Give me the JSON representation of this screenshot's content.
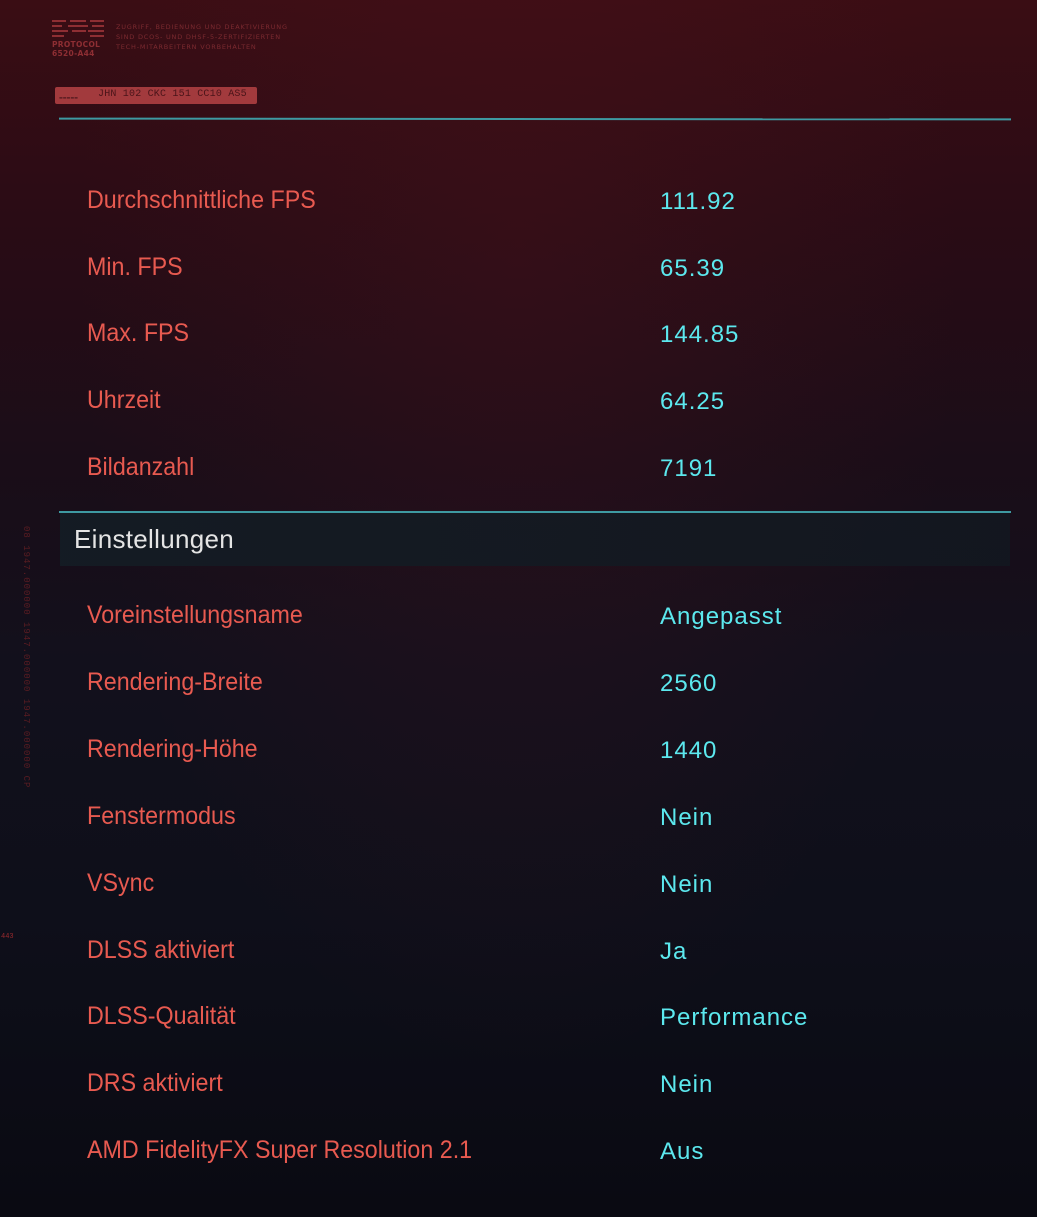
{
  "header": {
    "logo_word_1": "PROTOCOL",
    "logo_word_2": "6520-A44",
    "notice_line_1": "ZUGRIFF, BEDIENUNG UND DEAKTIVIERUNG",
    "notice_line_2": "SIND DCOS- UND DHSF-5-ZERTIFIZIERTEN",
    "notice_line_3": "TECH-MITARBEITERN VORBEHALTEN",
    "tag_code": "JHN 102 CKC 151 CC10 AS5"
  },
  "stats": [
    {
      "label": "Durchschnittliche FPS",
      "value": "111.92"
    },
    {
      "label": "Min. FPS",
      "value": "65.39"
    },
    {
      "label": "Max. FPS",
      "value": "144.85"
    },
    {
      "label": "Uhrzeit",
      "value": "64.25"
    },
    {
      "label": "Bildanzahl",
      "value": "7191"
    }
  ],
  "settings_section": {
    "title": "Einstellungen"
  },
  "settings": [
    {
      "label": "Voreinstellungsname",
      "value": "Angepasst"
    },
    {
      "label": "Rendering-Breite",
      "value": "2560"
    },
    {
      "label": "Rendering-Höhe",
      "value": "1440"
    },
    {
      "label": "Fenstermodus",
      "value": "Nein"
    },
    {
      "label": "VSync",
      "value": "Nein"
    },
    {
      "label": "DLSS aktiviert",
      "value": "Ja"
    },
    {
      "label": "DLSS-Qualität",
      "value": "Performance"
    },
    {
      "label": "DRS aktiviert",
      "value": "Nein"
    },
    {
      "label": "AMD FidelityFX Super Resolution 2.1",
      "value": "Aus"
    }
  ],
  "side": {
    "vertical_code": "08 1947.000000 1947.000000 1947.000000 CP",
    "number": "443"
  },
  "colors": {
    "label": "#e85a50",
    "value": "#5ce8ee",
    "divider": "#3e9aa2",
    "section_title": "#e4e4e4"
  }
}
